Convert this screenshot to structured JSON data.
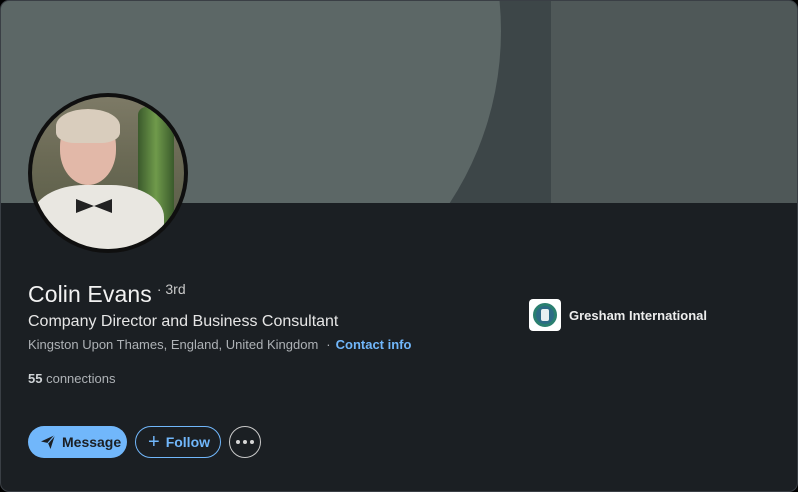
{
  "profile": {
    "name": "Colin Evans",
    "degree": "· 3rd",
    "headline": "Company Director and Business Consultant",
    "location": "Kingston Upon Thames, England, United Kingdom",
    "contact_info_label": "Contact info",
    "connections_count": "55",
    "connections_label": "connections"
  },
  "company": {
    "name": "Gresham International"
  },
  "actions": {
    "message_label": "Message",
    "follow_label": "Follow",
    "message_icon": "send-icon",
    "follow_icon": "plus-icon",
    "more_icon": "more-horizontal-icon"
  },
  "colors": {
    "accent": "#71b7fb",
    "card_bg": "#1b1f23"
  }
}
